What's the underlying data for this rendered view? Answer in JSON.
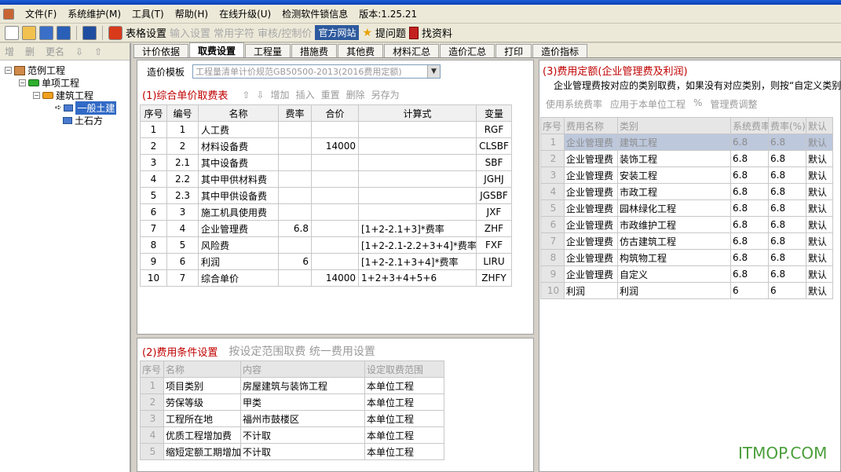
{
  "menu": [
    "文件(F)",
    "系统维护(M)",
    "工具(T)",
    "帮助(H)",
    "在线升级(U)",
    "检测软件锁信息",
    "版本:1.25.21"
  ],
  "toolbar": {
    "table_settings": "表格设置",
    "input_settings": "输入设置",
    "common_chars": "常用字符",
    "audit_control": "审核/控制价",
    "official_site": "官方网站",
    "ask_question": "提问题",
    "find_docs": "找资料"
  },
  "left_tools": [
    "增",
    "删",
    "更名",
    "⇩",
    "⇧"
  ],
  "tree": {
    "root": "范例工程",
    "item": "单项工程",
    "building": "建筑工程",
    "general": "一般土建",
    "earthwork": "土石方"
  },
  "tabs": [
    "计价依据",
    "取费设置",
    "工程量",
    "措施费",
    "其他费",
    "材料汇总",
    "造价汇总",
    "打印",
    "造价指标"
  ],
  "active_tab": 1,
  "template": {
    "label": "造价模板",
    "value": "工程量清单计价规范GB50500-2013(2016费用定额)"
  },
  "fee_table": {
    "title": "(1)综合单价取费表",
    "actions": [
      "⇧",
      "⇩",
      "增加",
      "插入",
      "重置",
      "删除",
      "另存为"
    ],
    "headers": [
      "序号",
      "编号",
      "名称",
      "费率",
      "合价",
      "计算式",
      "变量"
    ],
    "rows": [
      [
        "1",
        "1",
        "人工费",
        "",
        "",
        "",
        "RGF"
      ],
      [
        "2",
        "2",
        "材料设备费",
        "",
        "14000",
        "",
        "CLSBF"
      ],
      [
        "3",
        "2.1",
        "其中设备费",
        "",
        "",
        "",
        "SBF"
      ],
      [
        "4",
        "2.2",
        "其中甲供材料费",
        "",
        "",
        "",
        "JGHJ"
      ],
      [
        "5",
        "2.3",
        "其中甲供设备费",
        "",
        "",
        "",
        "JGSBF"
      ],
      [
        "6",
        "3",
        "施工机具使用费",
        "",
        "",
        "",
        "JXF"
      ],
      [
        "7",
        "4",
        "企业管理费",
        "6.8",
        "",
        "[1+2-2.1+3]*费率",
        "ZHF"
      ],
      [
        "8",
        "5",
        "风险费",
        "",
        "",
        "[1+2-2.1-2.2+3+4]*费率",
        "FXF"
      ],
      [
        "9",
        "6",
        "利润",
        "6",
        "",
        "[1+2-2.1+3+4]*费率",
        "LIRU"
      ],
      [
        "10",
        "7",
        "综合单价",
        "",
        "14000",
        "1+2+3+4+5+6",
        "ZHFY"
      ]
    ]
  },
  "cond": {
    "title": "(2)费用条件设置",
    "tail": "按设定范围取费 统一费用设置",
    "headers": [
      "序号",
      "名称",
      "内容",
      "设定取费范围"
    ],
    "rows": [
      [
        "1",
        "项目类别",
        "房屋建筑与装饰工程",
        "本单位工程"
      ],
      [
        "2",
        "劳保等级",
        "甲类",
        "本单位工程"
      ],
      [
        "3",
        "工程所在地",
        "福州市鼓楼区",
        "本单位工程"
      ],
      [
        "4",
        "优质工程增加费",
        "不计取",
        "本单位工程"
      ],
      [
        "5",
        "缩短定额工期增加",
        "不计取",
        "本单位工程"
      ]
    ]
  },
  "quota": {
    "title": "(3)费用定额(企业管理费及利润)",
    "desc": "企业管理费按对应的类别取费，如果没有对应类别，则按“自定义类别",
    "actions": [
      "使用系统费率",
      "应用于本单位工程",
      "%",
      "管理费调整"
    ],
    "headers": [
      "序号",
      "费用名称",
      "类别",
      "系统费率(%)",
      "费率(%)",
      "默认"
    ],
    "rows": [
      [
        "1",
        "企业管理费",
        "建筑工程",
        "6.8",
        "6.8",
        "默认"
      ],
      [
        "2",
        "企业管理费",
        "装饰工程",
        "6.8",
        "6.8",
        "默认"
      ],
      [
        "3",
        "企业管理费",
        "安装工程",
        "6.8",
        "6.8",
        "默认"
      ],
      [
        "4",
        "企业管理费",
        "市政工程",
        "6.8",
        "6.8",
        "默认"
      ],
      [
        "5",
        "企业管理费",
        "园林绿化工程",
        "6.8",
        "6.8",
        "默认"
      ],
      [
        "6",
        "企业管理费",
        "市政维护工程",
        "6.8",
        "6.8",
        "默认"
      ],
      [
        "7",
        "企业管理费",
        "仿古建筑工程",
        "6.8",
        "6.8",
        "默认"
      ],
      [
        "8",
        "企业管理费",
        "构筑物工程",
        "6.8",
        "6.8",
        "默认"
      ],
      [
        "9",
        "企业管理费",
        "自定义",
        "6.8",
        "6.8",
        "默认"
      ],
      [
        "10",
        "利润",
        "利润",
        "6",
        "6",
        "默认"
      ]
    ]
  },
  "watermark": "ITMOP.COM"
}
